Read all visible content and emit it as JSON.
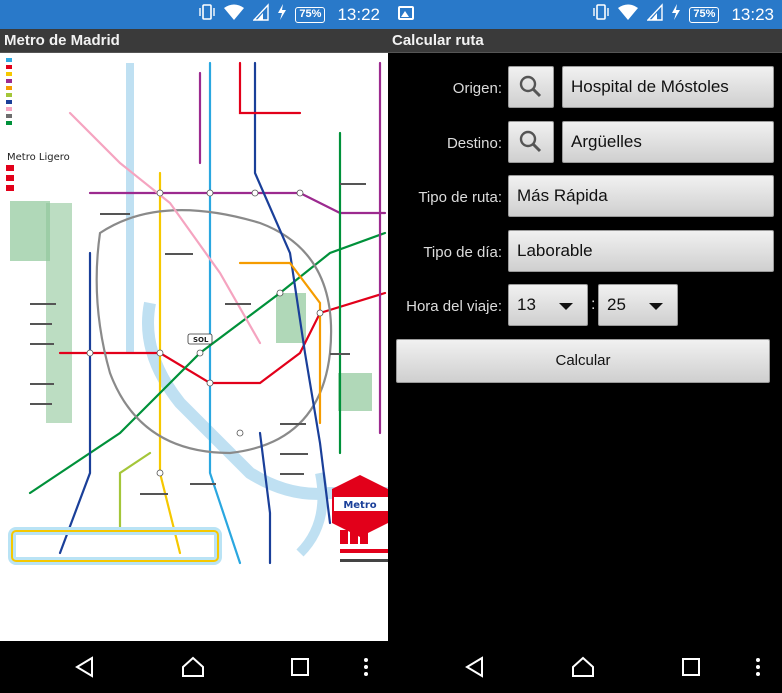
{
  "left": {
    "status": {
      "battery": "75%",
      "time": "13:22"
    },
    "app_title": "Metro de Madrid",
    "map": {
      "legend_heading": "Metro Ligero",
      "badges": {
        "sol": "SOL",
        "logo": "Metro"
      }
    }
  },
  "right": {
    "status": {
      "battery": "75%",
      "time": "13:23"
    },
    "app_title": "Calcular ruta",
    "form": {
      "origin_label": "Origen:",
      "origin_value": "Hospital de Móstoles",
      "destination_label": "Destino:",
      "destination_value": "Argüelles",
      "route_type_label": "Tipo de ruta:",
      "route_type_value": "Más Rápida",
      "day_type_label": "Tipo de día:",
      "day_type_value": "Laborable",
      "time_label": "Hora del viaje:",
      "hour_value": "13",
      "time_separator": ":",
      "minute_value": "25",
      "calculate_label": "Calcular"
    }
  },
  "colors": {
    "status_bar": "#2979c9",
    "app_bar": "#3a3a3a",
    "button_face": "#e0e0e0",
    "metro_red": "#e2001a"
  },
  "icons": [
    "vibrate-icon",
    "wifi-icon",
    "signal-icon",
    "charging-icon",
    "battery-icon",
    "gallery-icon",
    "search-icon",
    "back-icon",
    "home-icon",
    "recents-icon",
    "overflow-icon"
  ]
}
